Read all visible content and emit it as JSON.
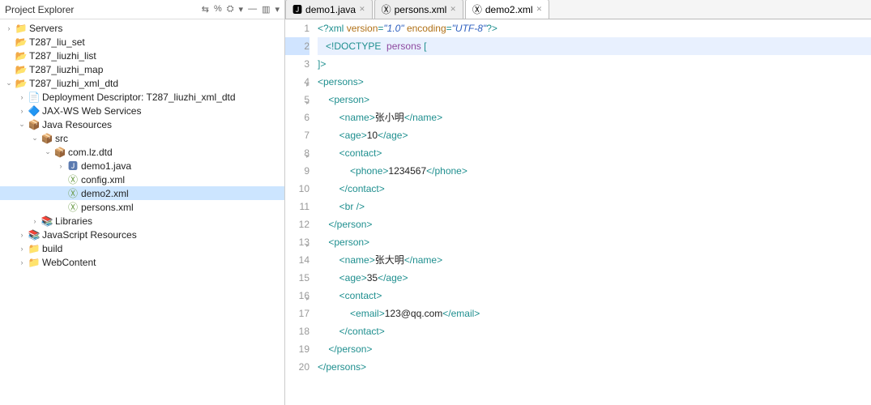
{
  "sidebar": {
    "title": "Project Explorer",
    "tools": [
      "⇆",
      "%",
      "⛭",
      "▾",
      "—",
      "▥",
      "▾"
    ],
    "tree": [
      {
        "d": 0,
        "tw": ">",
        "ic": "fldr",
        "lbl": "Servers"
      },
      {
        "d": 0,
        "tw": "",
        "ic": "prj",
        "lbl": "T287_liu_set"
      },
      {
        "d": 0,
        "tw": "",
        "ic": "prj",
        "lbl": "T287_liuzhi_list"
      },
      {
        "d": 0,
        "tw": "",
        "ic": "prj",
        "lbl": "T287_liuzhi_map"
      },
      {
        "d": 0,
        "tw": "v",
        "ic": "prj",
        "lbl": "T287_liuzhi_xml_dtd"
      },
      {
        "d": 1,
        "tw": ">",
        "ic": "doc",
        "lbl": "Deployment Descriptor: T287_liuzhi_xml_dtd"
      },
      {
        "d": 1,
        "tw": ">",
        "ic": "ws",
        "lbl": "JAX-WS Web Services"
      },
      {
        "d": 1,
        "tw": "v",
        "ic": "src",
        "lbl": "Java Resources"
      },
      {
        "d": 2,
        "tw": "v",
        "ic": "pkg",
        "lbl": "src"
      },
      {
        "d": 3,
        "tw": "v",
        "ic": "pkg",
        "lbl": "com.lz.dtd"
      },
      {
        "d": 4,
        "tw": ">",
        "ic": "java",
        "lbl": "demo1.java"
      },
      {
        "d": 4,
        "tw": "",
        "ic": "xml",
        "lbl": "config.xml"
      },
      {
        "d": 4,
        "tw": "",
        "ic": "xml",
        "lbl": "demo2.xml",
        "sel": true
      },
      {
        "d": 4,
        "tw": "",
        "ic": "xml",
        "lbl": "persons.xml"
      },
      {
        "d": 2,
        "tw": ">",
        "ic": "lib",
        "lbl": "Libraries"
      },
      {
        "d": 1,
        "tw": ">",
        "ic": "lib",
        "lbl": "JavaScript Resources"
      },
      {
        "d": 1,
        "tw": ">",
        "ic": "fldr",
        "lbl": "build"
      },
      {
        "d": 1,
        "tw": ">",
        "ic": "fldr",
        "lbl": "WebContent"
      }
    ]
  },
  "tabs": [
    {
      "ic": "java",
      "lbl": "demo1.java",
      "active": false
    },
    {
      "ic": "xml",
      "lbl": "persons.xml",
      "active": false
    },
    {
      "ic": "xml",
      "lbl": "demo2.xml",
      "active": true
    }
  ],
  "code": {
    "lines": [
      {
        "n": 1,
        "hl": false,
        "seg": [
          [
            "<?",
            "pi"
          ],
          [
            "xml ",
            "pi"
          ],
          [
            "version",
            "attr"
          ],
          [
            "=",
            "tag"
          ],
          [
            "\"1.0\"",
            "val"
          ],
          [
            " ",
            "txt"
          ],
          [
            "encoding",
            "attr"
          ],
          [
            "=",
            "tag"
          ],
          [
            "\"UTF-8\"",
            "val"
          ],
          [
            "?>",
            "pi"
          ]
        ]
      },
      {
        "n": 2,
        "hl": true,
        "seg": [
          [
            "   ",
            "txt"
          ],
          [
            "<!DOCTYPE  ",
            "doct"
          ],
          [
            "persons ",
            "kw"
          ],
          [
            "[",
            "doct"
          ]
        ]
      },
      {
        "n": 3,
        "hl": false,
        "seg": [
          [
            "]",
            "doct"
          ],
          [
            ">",
            "doct"
          ]
        ]
      },
      {
        "n": 4,
        "hl": false,
        "fold": true,
        "seg": [
          [
            "<persons>",
            "tag"
          ]
        ]
      },
      {
        "n": 5,
        "hl": false,
        "fold": true,
        "seg": [
          [
            "    ",
            "txt"
          ],
          [
            "<person>",
            "tag"
          ]
        ]
      },
      {
        "n": 6,
        "hl": false,
        "seg": [
          [
            "        ",
            "txt"
          ],
          [
            "<name>",
            "tag"
          ],
          [
            "张小明",
            "txt"
          ],
          [
            "</name>",
            "tag"
          ]
        ]
      },
      {
        "n": 7,
        "hl": false,
        "seg": [
          [
            "        ",
            "txt"
          ],
          [
            "<age>",
            "tag"
          ],
          [
            "10",
            "txt"
          ],
          [
            "</age>",
            "tag"
          ]
        ]
      },
      {
        "n": 8,
        "hl": false,
        "fold": true,
        "seg": [
          [
            "        ",
            "txt"
          ],
          [
            "<contact>",
            "tag"
          ]
        ]
      },
      {
        "n": 9,
        "hl": false,
        "seg": [
          [
            "            ",
            "txt"
          ],
          [
            "<phone>",
            "tag"
          ],
          [
            "1234567",
            "txt"
          ],
          [
            "</phone>",
            "tag"
          ]
        ]
      },
      {
        "n": 10,
        "hl": false,
        "seg": [
          [
            "        ",
            "txt"
          ],
          [
            "</contact>",
            "tag"
          ]
        ]
      },
      {
        "n": 11,
        "hl": false,
        "seg": [
          [
            "        ",
            "txt"
          ],
          [
            "<br />",
            "tag"
          ]
        ]
      },
      {
        "n": 12,
        "hl": false,
        "seg": [
          [
            "    ",
            "txt"
          ],
          [
            "</person>",
            "tag"
          ]
        ]
      },
      {
        "n": 13,
        "hl": false,
        "fold": true,
        "seg": [
          [
            "    ",
            "txt"
          ],
          [
            "<person>",
            "tag"
          ]
        ]
      },
      {
        "n": 14,
        "hl": false,
        "seg": [
          [
            "        ",
            "txt"
          ],
          [
            "<name>",
            "tag"
          ],
          [
            "张大明",
            "txt"
          ],
          [
            "</name>",
            "tag"
          ]
        ]
      },
      {
        "n": 15,
        "hl": false,
        "seg": [
          [
            "        ",
            "txt"
          ],
          [
            "<age>",
            "tag"
          ],
          [
            "35",
            "txt"
          ],
          [
            "</age>",
            "tag"
          ]
        ]
      },
      {
        "n": 16,
        "hl": false,
        "fold": true,
        "seg": [
          [
            "        ",
            "txt"
          ],
          [
            "<contact>",
            "tag"
          ]
        ]
      },
      {
        "n": 17,
        "hl": false,
        "seg": [
          [
            "            ",
            "txt"
          ],
          [
            "<email>",
            "tag"
          ],
          [
            "123@qq.com",
            "txt"
          ],
          [
            "</email>",
            "tag"
          ]
        ]
      },
      {
        "n": 18,
        "hl": false,
        "seg": [
          [
            "        ",
            "txt"
          ],
          [
            "</contact>",
            "tag"
          ]
        ]
      },
      {
        "n": 19,
        "hl": false,
        "seg": [
          [
            "    ",
            "txt"
          ],
          [
            "</person>",
            "tag"
          ]
        ]
      },
      {
        "n": 20,
        "hl": false,
        "seg": [
          [
            "</persons>",
            "tag"
          ]
        ]
      }
    ]
  },
  "icons": {
    "fldr": "📁",
    "prj": "📂",
    "doc": "📄",
    "ws": "🔷",
    "src": "📦",
    "pkg": "📦",
    "java": "🅹",
    "xml": "Ⓧ",
    "lib": "📚"
  }
}
